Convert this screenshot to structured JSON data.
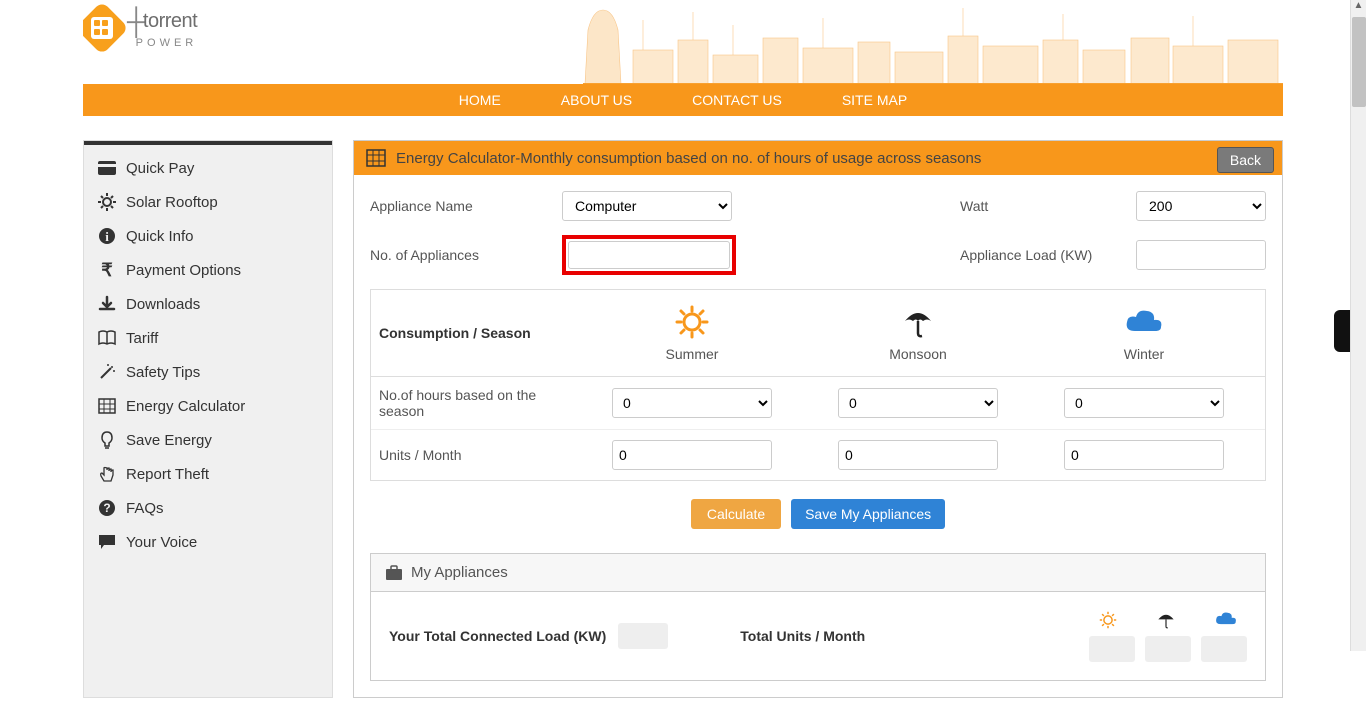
{
  "logo": {
    "brand_first": "t",
    "brand_rest": "orrent",
    "sub": "POWER"
  },
  "nav": {
    "home": "HOME",
    "about": "ABOUT US",
    "contact": "CONTACT US",
    "sitemap": "SITE MAP"
  },
  "sidebar": {
    "items": [
      {
        "label": "Quick Pay",
        "icon": "card"
      },
      {
        "label": "Solar Rooftop",
        "icon": "gear"
      },
      {
        "label": "Quick Info",
        "icon": "info"
      },
      {
        "label": "Payment Options",
        "icon": "rupee"
      },
      {
        "label": "Downloads",
        "icon": "download"
      },
      {
        "label": "Tariff",
        "icon": "book"
      },
      {
        "label": "Safety Tips",
        "icon": "wand"
      },
      {
        "label": "Energy Calculator",
        "icon": "grid"
      },
      {
        "label": "Save Energy",
        "icon": "bulb"
      },
      {
        "label": "Report Theft",
        "icon": "hand"
      },
      {
        "label": "FAQs",
        "icon": "help"
      },
      {
        "label": "Your Voice",
        "icon": "chat"
      }
    ]
  },
  "panel": {
    "title": "Energy Calculator-Monthly consumption based on no. of hours of usage across seasons",
    "back": "Back",
    "appliance_name_label": "Appliance Name",
    "appliance_name_value": "Computer",
    "watt_label": "Watt",
    "watt_value": "200",
    "no_appl_label": "No. of Appliances",
    "no_appl_value": "",
    "load_label": "Appliance Load (KW)",
    "load_value": "",
    "season_header": "Consumption / Season",
    "seasons": {
      "summer": "Summer",
      "monsoon": "Monsoon",
      "winter": "Winter"
    },
    "hours_label": "No.of hours based on the season",
    "hours": {
      "summer": "0",
      "monsoon": "0",
      "winter": "0"
    },
    "units_label": "Units / Month",
    "units": {
      "summer": "0",
      "monsoon": "0",
      "winter": "0"
    },
    "calc_btn": "Calculate",
    "save_btn": "Save My Appliances"
  },
  "my_appl": {
    "title": "My Appliances",
    "total_load_label": "Your Total Connected Load (KW)",
    "total_units_label": "Total Units / Month"
  }
}
